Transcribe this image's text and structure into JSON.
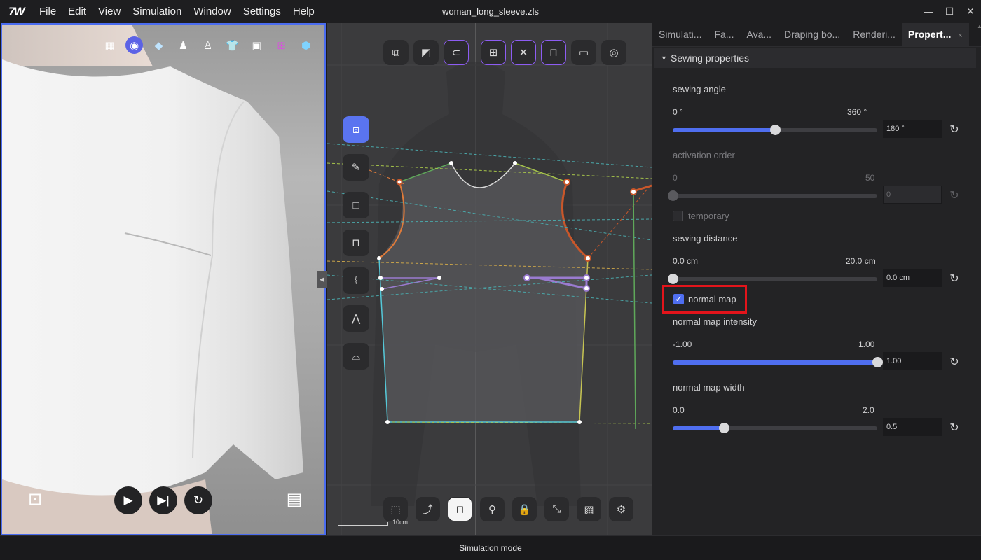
{
  "app": {
    "window_title": "woman_long_sleeve.zls",
    "logo_text": "7W",
    "menu": [
      "File",
      "Edit",
      "View",
      "Simulation",
      "Window",
      "Settings",
      "Help"
    ],
    "window_controls": [
      "—",
      "☐",
      "✕"
    ]
  },
  "viewport3d": {
    "top_icons": [
      "mesh-icon",
      "texture-sphere-icon",
      "fabric-block-icon",
      "avatar-icon",
      "avatar-color-icon",
      "garment-icon",
      "layer-icon",
      "sewing-machine-icon",
      "cube-icon"
    ],
    "buttons": {
      "snapshot": "snapshot-icon",
      "play": "play-icon",
      "step": "step-forward-icon",
      "reset": "reset-icon",
      "record": "film-icon"
    }
  },
  "pattern2d": {
    "top_tools": [
      "pattern-icon",
      "pattern-edit-icon",
      "magnet-icon",
      "grid-icon",
      "needle-icon",
      "sew-icon",
      "flatten-icon",
      "tape-icon"
    ],
    "left_tools": [
      "transform-pattern-icon",
      "pen-icon",
      "rectangle-icon",
      "sewing-machine-icon",
      "zipper-icon",
      "fold-icon",
      "measure-icon"
    ],
    "bottom_tools": [
      "select-icon",
      "edit-curve-icon",
      "sewing-select-icon",
      "pin-icon",
      "lock-icon",
      "cut-icon",
      "image-icon",
      "settings-icon"
    ],
    "scale_label": "10cm"
  },
  "right_panel": {
    "tabs": [
      "Simulati...",
      "Fa...",
      "Ava...",
      "Draping bo...",
      "Renderi...",
      "Propert..."
    ],
    "active_tab_close": "×",
    "section_title": "Sewing properties",
    "sewing_angle": {
      "label": "sewing angle",
      "min": "0 °",
      "max": "360 °",
      "value": "180 °",
      "fraction": 0.5
    },
    "activation_order": {
      "label": "activation order",
      "min": "0",
      "max": "50",
      "value": "0",
      "fraction": 0.0
    },
    "temporary": {
      "label": "temporary",
      "checked": false
    },
    "sewing_distance": {
      "label": "sewing distance",
      "min": "0.0 cm",
      "max": "20.0 cm",
      "value": "0.0 cm",
      "fraction": 0.0
    },
    "normal_map": {
      "label": "normal map",
      "checked": true
    },
    "normal_map_intensity": {
      "label": "normal map intensity",
      "min": "-1.00",
      "max": "1.00",
      "value": "1.00",
      "fraction": 1.0
    },
    "normal_map_width": {
      "label": "normal map width",
      "min": "0.0",
      "max": "2.0",
      "value": "0.5",
      "fraction": 0.25
    }
  },
  "status_bar": {
    "text": "Simulation mode"
  },
  "colors": {
    "accent": "#4f6ef0",
    "highlight": "#e3141b",
    "viewport_border": "#4a6cf0"
  }
}
